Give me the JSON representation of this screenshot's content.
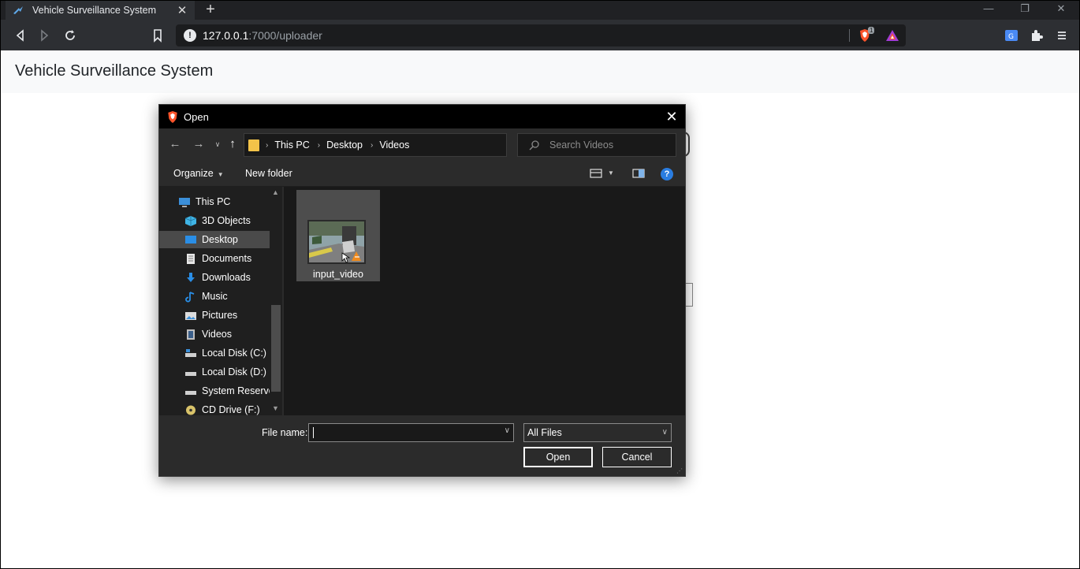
{
  "browser": {
    "tab_title": "Vehicle Surveillance System",
    "url_host": "127.0.0.1",
    "url_path": ":7000/uploader",
    "shield_count": "1"
  },
  "page": {
    "brand": "Vehicle Surveillance System"
  },
  "dialog": {
    "title": "Open",
    "breadcrumb": [
      "This PC",
      "Desktop",
      "Videos"
    ],
    "search_placeholder": "Search Videos",
    "organize_label": "Organize",
    "new_folder_label": "New folder",
    "nav_items": [
      {
        "label": "This PC",
        "icon": "computer-icon"
      },
      {
        "label": "3D Objects",
        "icon": "3d-objects-icon"
      },
      {
        "label": "Desktop",
        "icon": "desktop-icon",
        "selected": true
      },
      {
        "label": "Documents",
        "icon": "documents-icon"
      },
      {
        "label": "Downloads",
        "icon": "downloads-icon"
      },
      {
        "label": "Music",
        "icon": "music-icon"
      },
      {
        "label": "Pictures",
        "icon": "pictures-icon"
      },
      {
        "label": "Videos",
        "icon": "videos-icon"
      },
      {
        "label": "Local Disk (C:)",
        "icon": "drive-icon"
      },
      {
        "label": "Local Disk (D:)",
        "icon": "drive-icon"
      },
      {
        "label": "System Reserved",
        "icon": "drive-icon"
      },
      {
        "label": "CD Drive (F:)",
        "icon": "cd-drive-icon"
      }
    ],
    "files": [
      {
        "name": "input_video",
        "icon": "video-file-thumbnail"
      }
    ],
    "file_name_label": "File name:",
    "file_name_value": "",
    "file_type": "All Files",
    "open_label": "Open",
    "cancel_label": "Cancel"
  },
  "colors": {
    "dialog_bg": "#2b2b2b",
    "content_bg": "#191919",
    "accent_blue": "#2a7de1",
    "folder_yellow": "#f3c349"
  }
}
